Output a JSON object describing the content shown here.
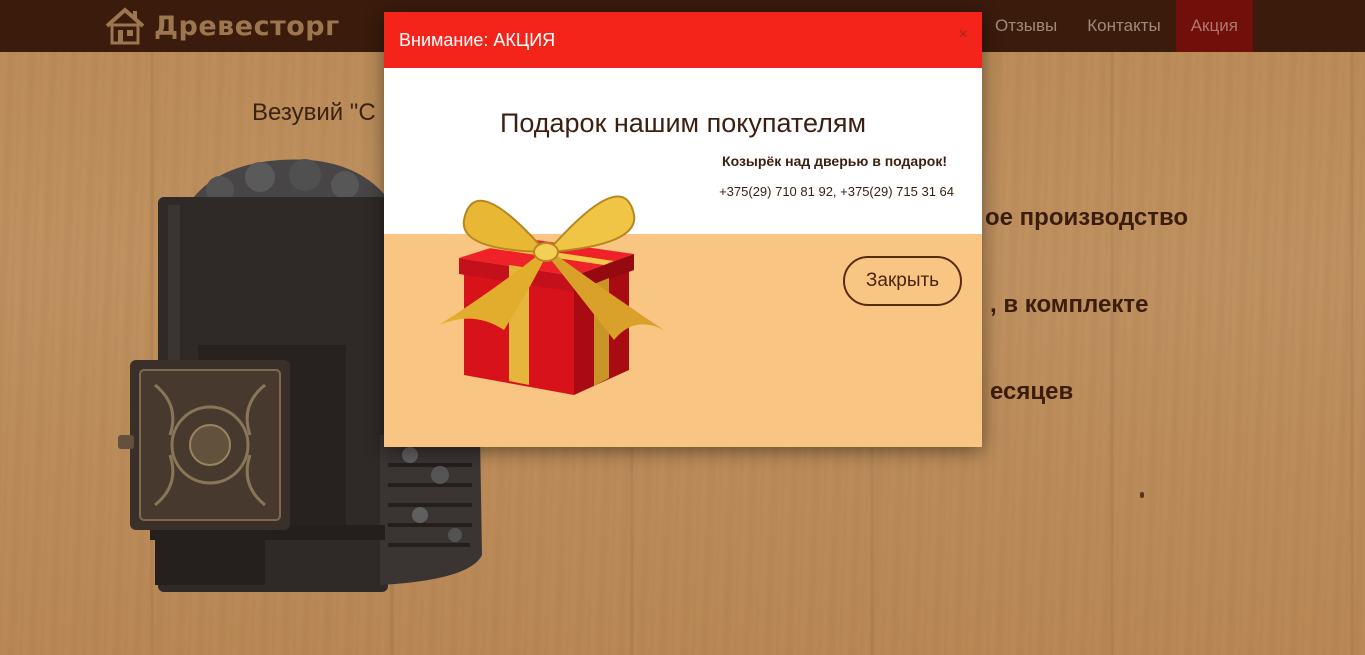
{
  "navbar": {
    "logo_text": "Древесторг",
    "links": [
      {
        "label": "Отзывы",
        "active": false
      },
      {
        "label": "Контакты",
        "active": false
      },
      {
        "label": "Акция",
        "active": true
      }
    ]
  },
  "page": {
    "product_title": "Везувий \"С",
    "features": [
      "ое производство",
      ", в комплекте",
      "есяцев"
    ]
  },
  "modal": {
    "title": "Внимание: АКЦИЯ",
    "close_x": "×",
    "heading": "Подарок нашим покупателям",
    "subheading": "Козырёк над дверью в подарок!",
    "phones": "+375(29) 710 81 92, +375(29) 715 31 64",
    "close_button": "Закрыть"
  },
  "colors": {
    "navbar_bg": "#3a1c0d",
    "nav_active_bg": "#7d0d0a",
    "modal_header_bg": "#f5241a",
    "modal_bottom_bg": "#f8c682"
  },
  "icons": [
    "house-logo-icon",
    "gift-box-icon",
    "sauna-stove-image"
  ]
}
